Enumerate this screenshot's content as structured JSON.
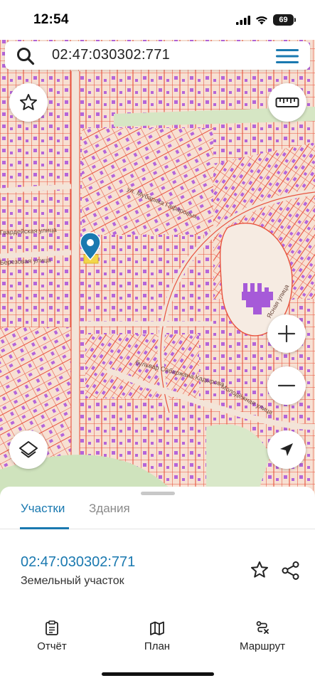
{
  "status_bar": {
    "time": "12:54",
    "battery": "69"
  },
  "search": {
    "query": "02:47:030302:771"
  },
  "map": {
    "street_labels": [
      "ул. Мубаряка Гафаровых",
      "Гвардейская улица",
      "Березовая улица",
      "бульвар Сабиржана Кадырова",
      "Молодёжная улица",
      "Ясная улица"
    ],
    "marker": "location-pin"
  },
  "tabs": {
    "active": "Участки",
    "inactive": "Здания"
  },
  "parcel": {
    "cadastral_number": "02:47:030302:771",
    "type": "Земельный участок"
  },
  "bottom_nav": {
    "items": [
      {
        "label": "Отчёт",
        "icon": "report-icon"
      },
      {
        "label": "План",
        "icon": "map-icon"
      },
      {
        "label": "Маршрут",
        "icon": "route-icon"
      }
    ]
  },
  "colors": {
    "accent": "#1a79b0",
    "parcel_line": "#e8533f",
    "building": "#a65ad8",
    "map_bg": "#f5dccd",
    "park": "#cfe3bd"
  }
}
